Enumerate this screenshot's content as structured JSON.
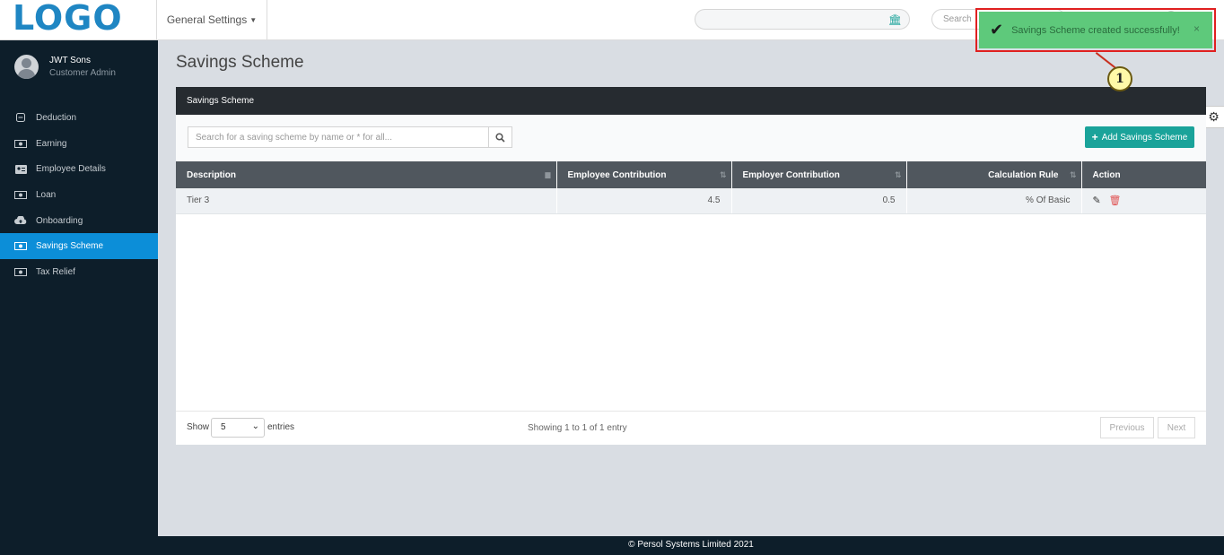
{
  "header": {
    "logo": "LOGO",
    "menu_label": "General Settings",
    "search2_placeholder": "Search"
  },
  "toast": {
    "message": "Savings Scheme created successfully!",
    "close": "×",
    "callout": "1"
  },
  "user": {
    "name": "JWT Sons",
    "role": "Customer Admin"
  },
  "sidebar": {
    "items": [
      {
        "label": "Deduction",
        "icon": "minus-box-icon"
      },
      {
        "label": "Earning",
        "icon": "money-icon"
      },
      {
        "label": "Employee Details",
        "icon": "id-card-icon"
      },
      {
        "label": "Loan",
        "icon": "money-icon"
      },
      {
        "label": "Onboarding",
        "icon": "cloud-upload-icon"
      },
      {
        "label": "Savings Scheme",
        "icon": "money-icon",
        "active": true
      },
      {
        "label": "Tax Relief",
        "icon": "money-icon"
      }
    ]
  },
  "page": {
    "title": "Savings Scheme",
    "card_title": "Savings Scheme",
    "search_placeholder": "Search for a saving scheme by name or * for all...",
    "add_button": "Add Savings Scheme"
  },
  "table": {
    "columns": [
      "Description",
      "Employee Contribution",
      "Employer Contribution",
      "Calculation Rule",
      "Action"
    ],
    "rows": [
      {
        "description": "Tier 3",
        "employee_contribution": "4.5",
        "employer_contribution": "0.5",
        "calculation_rule": "% Of Basic"
      }
    ]
  },
  "pagination": {
    "show_label": "Show",
    "page_size": "5",
    "entries_label": "entries",
    "info": "Showing 1 to 1 of 1 entry",
    "previous": "Previous",
    "next": "Next"
  },
  "footer": {
    "copyright": "© Persol Systems Limited 2021"
  },
  "colors": {
    "accent": "#0c8ed8",
    "teal": "#1aa39a",
    "sidebar_bg": "#0d1e2a",
    "toast_bg": "#5ec97b",
    "toast_border": "#e02020"
  }
}
